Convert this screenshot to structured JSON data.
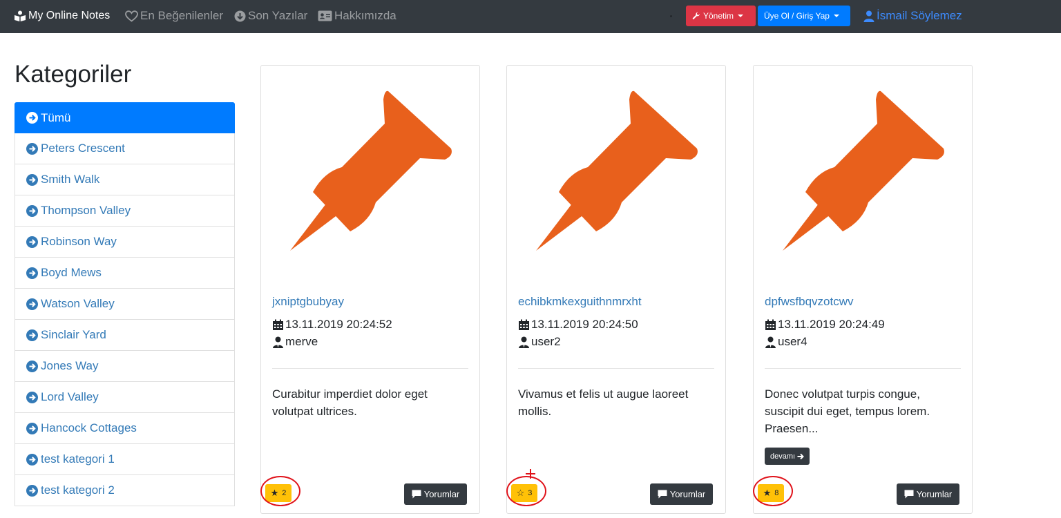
{
  "navbar": {
    "brand": "My Online Notes",
    "links": [
      {
        "label": "En Beğenilenler",
        "icon": "heart-icon"
      },
      {
        "label": "Son Yazılar",
        "icon": "arrow-circle-down-icon"
      },
      {
        "label": "Hakkımızda",
        "icon": "id-card-icon"
      }
    ],
    "admin_label": "Yönetim",
    "login_label": "Üye Ol / Giriş Yap",
    "user_label": "İsmail Söylemez",
    "colors": {
      "background": "#343a40",
      "admin": "#dc3545",
      "login": "#007bff",
      "user": "#3d8bfd"
    }
  },
  "sidebar": {
    "title": "Kategoriler",
    "items": [
      {
        "label": "Tümü",
        "active": true
      },
      {
        "label": "Peters Crescent"
      },
      {
        "label": "Smith Walk"
      },
      {
        "label": "Thompson Valley"
      },
      {
        "label": "Robinson Way"
      },
      {
        "label": "Boyd Mews"
      },
      {
        "label": "Watson Valley"
      },
      {
        "label": "Sinclair Yard"
      },
      {
        "label": "Jones Way"
      },
      {
        "label": "Lord Valley"
      },
      {
        "label": "Hancock Cottages"
      },
      {
        "label": "test kategori 1"
      },
      {
        "label": "test kategori 2"
      }
    ]
  },
  "notes": [
    {
      "title": "jxniptgbubyay",
      "date": "13.11.2019 20:24:52",
      "user": "merve",
      "text": "Curabitur imperdiet dolor eget volutpat ultrices.",
      "likes": "2",
      "liked": true,
      "comments_label": "Yorumlar"
    },
    {
      "title": "echibkmkexguithnmrxht",
      "date": "13.11.2019 20:24:50",
      "user": "user2",
      "text": "Vivamus et felis ut augue laoreet mollis.",
      "likes": "3",
      "liked": false,
      "comments_label": "Yorumlar"
    },
    {
      "title": "dpfwsfbqvzotcwv",
      "date": "13.11.2019 20:24:49",
      "user": "user4",
      "text": "Donec volutpat turpis congue, suscipit dui eget, tempus lorem. Praesen...",
      "more_label": "devamı",
      "likes": "8",
      "liked": true,
      "comments_label": "Yorumlar"
    }
  ],
  "colors": {
    "pin": "#e8601c",
    "badge": "#ffc107",
    "annotation": "#e0121a",
    "link": "#337ab7"
  }
}
